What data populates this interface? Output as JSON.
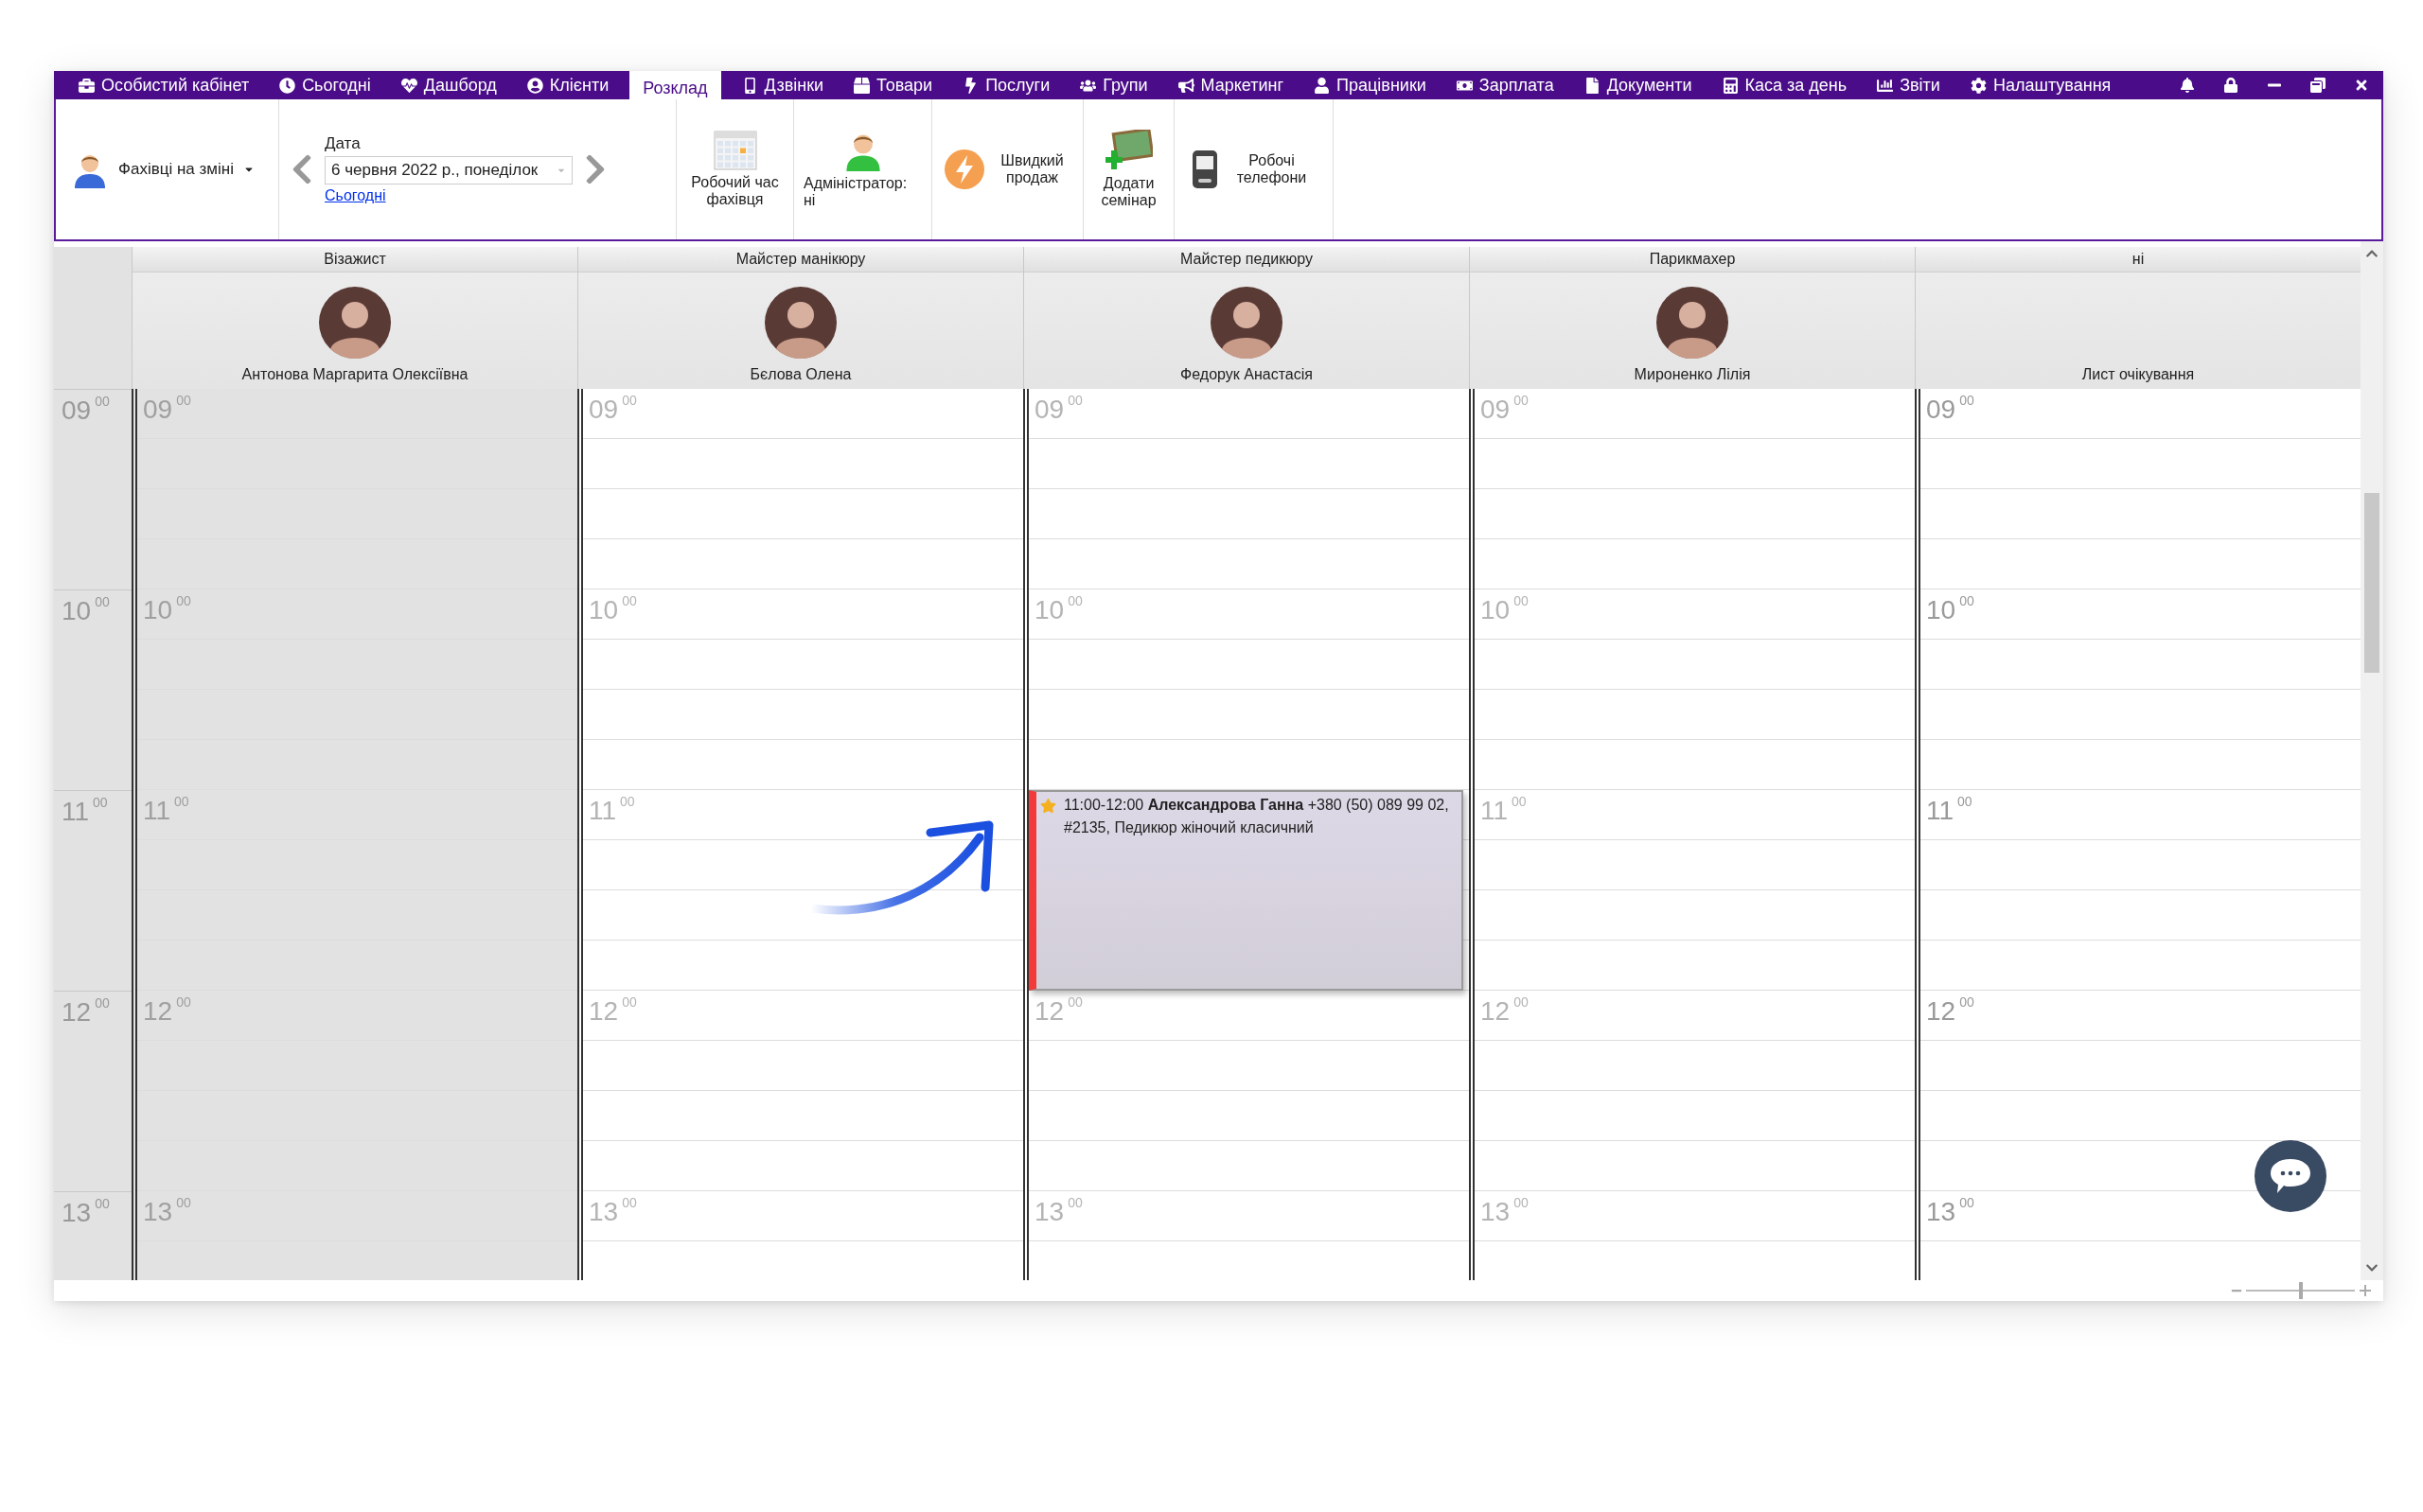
{
  "menu": {
    "items": [
      {
        "label": "Особистий кабінет",
        "selected": false
      },
      {
        "label": "Сьогодні",
        "selected": false
      },
      {
        "label": "Дашборд",
        "selected": false
      },
      {
        "label": "Клієнти",
        "selected": false
      },
      {
        "label": "Розклад",
        "selected": true
      },
      {
        "label": "Дзвінки",
        "selected": false
      },
      {
        "label": "Товари",
        "selected": false
      },
      {
        "label": "Послуги",
        "selected": false
      },
      {
        "label": "Групи",
        "selected": false
      },
      {
        "label": "Маркетинг",
        "selected": false
      },
      {
        "label": "Працівники",
        "selected": false
      },
      {
        "label": "Зарплата",
        "selected": false
      },
      {
        "label": "Документи",
        "selected": false
      },
      {
        "label": "Каса за день",
        "selected": false
      },
      {
        "label": "Звіти",
        "selected": false
      },
      {
        "label": "Налаштування",
        "selected": false
      }
    ]
  },
  "toolbar": {
    "staff_filter": {
      "label": "Фахівці на зміні"
    },
    "date": {
      "label": "Дата",
      "value": "6 червня 2022 р., понеділок",
      "today_link": "Сьогодні"
    },
    "buttons": [
      {
        "kind": "calendar",
        "label": "Робочий час фахівця"
      },
      {
        "kind": "admin",
        "label": "Адміністратор: ні"
      },
      {
        "kind": "sale",
        "label": "Швидкий продаж"
      },
      {
        "kind": "seminar",
        "label": "Додати семінар"
      },
      {
        "kind": "phone",
        "label": "Робочі телефони"
      }
    ]
  },
  "zoom": {
    "level": 0.5
  },
  "schedule": {
    "time_labels": [
      {
        "h": "09",
        "m": "00"
      },
      {
        "h": "10",
        "m": "00"
      },
      {
        "h": "11",
        "m": "00"
      },
      {
        "h": "12",
        "m": "00"
      },
      {
        "h": "13",
        "m": "00"
      }
    ],
    "columns": [
      {
        "kind": "staff",
        "title": "Візажист",
        "name": "Антонова Маргарита Олексіївна",
        "working": false,
        "hours": [
          {
            "h": "09",
            "m": "00"
          },
          {
            "h": "10",
            "m": "00"
          },
          {
            "h": "11",
            "m": "00"
          },
          {
            "h": "12",
            "m": "00"
          },
          {
            "h": "13",
            "m": "00"
          }
        ]
      },
      {
        "kind": "staff",
        "title": "Майстер манікюру",
        "name": "Бєлова Олена",
        "working": true,
        "hours": [
          {
            "h": "09",
            "m": "00"
          },
          {
            "h": "10",
            "m": "00"
          },
          {
            "h": "11",
            "m": "00"
          },
          {
            "h": "12",
            "m": "00"
          },
          {
            "h": "13",
            "m": "00"
          }
        ]
      },
      {
        "kind": "staff",
        "title": "Майстер педикюру",
        "name": "Федорук Анастасія",
        "working": true,
        "hours": [
          {
            "h": "09",
            "m": "00"
          },
          {
            "h": "10",
            "m": "00"
          },
          {
            "appointments": [
              {
                "text": "11:00-12:00 **Александрова Ганна** +380 (50) 089 99 02, #2135, Педикюр жіночий класичний"
              }
            ]
          },
          {
            "h": "12",
            "m": "00"
          },
          {
            "h": "13",
            "m": "00"
          }
        ]
      },
      {
        "kind": "staff",
        "title": "Парикмахер",
        "name": "Мироненко Лілія",
        "working": true,
        "hours": [
          {
            "h": "09",
            "m": "00"
          },
          {
            "h": "10",
            "m": "00"
          },
          {
            "h": "11",
            "m": "00"
          },
          {
            "h": "12",
            "m": "00"
          },
          {
            "h": "13",
            "m": "00"
          }
        ]
      },
      {
        "kind": "waitlist",
        "title": "ні",
        "name": "Лист очікування",
        "working": true,
        "hours": [
          {
            "h": "09",
            "m": "00"
          },
          {
            "h": "10",
            "m": "00"
          },
          {
            "h": "11",
            "m": "00"
          },
          {
            "h": "12",
            "m": "00"
          },
          {
            "h": "13",
            "m": "00"
          }
        ]
      }
    ]
  }
}
